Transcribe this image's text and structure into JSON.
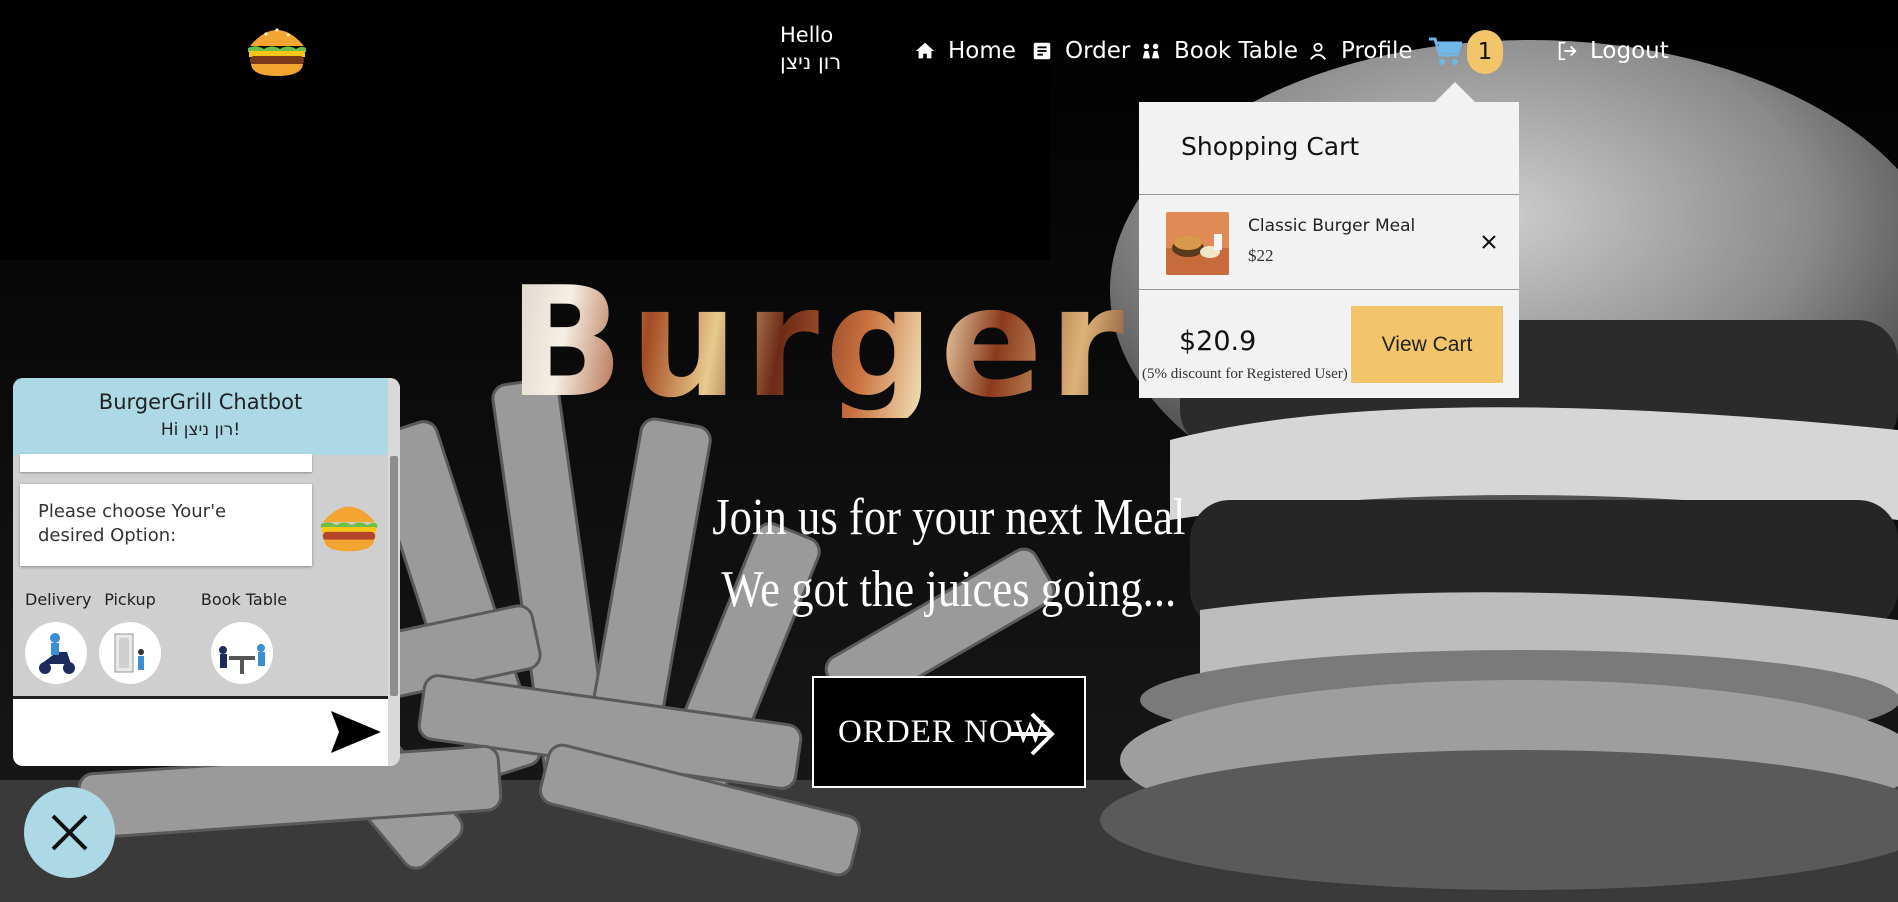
{
  "header": {
    "logo_icon": "burger-icon",
    "greeting": "Hello",
    "user_name": "רון ניצן",
    "nav": [
      {
        "label": "Home",
        "icon": "home-icon"
      },
      {
        "label": "Order",
        "icon": "menu-book-icon"
      },
      {
        "label": "Book Table",
        "icon": "people-icon"
      },
      {
        "label": "Profile",
        "icon": "person-icon"
      }
    ],
    "cart_count": "1",
    "logout_label": "Logout"
  },
  "cart_dropdown": {
    "title": "Shopping Cart",
    "items": [
      {
        "name": "Classic Burger Meal",
        "price": "$22"
      }
    ],
    "total": "$20.9",
    "discount_note": "(5% discount for Registered User)",
    "view_cart_label": "View Cart"
  },
  "hero": {
    "title": "Burger G",
    "tagline_1": "Join us for your next Meal",
    "tagline_2": "We got the juices going...",
    "cta_label": "ORDER NOW"
  },
  "chatbot": {
    "title": "BurgerGrill Chatbot",
    "greeting": "Hi רון ניצן!",
    "message": "Please choose Your'e desired Option:",
    "options": [
      {
        "label": "Delivery",
        "icon": "delivery-scooter-icon"
      },
      {
        "label": "Pickup",
        "icon": "pickup-door-icon"
      },
      {
        "label": "Book Table",
        "icon": "dining-table-icon"
      }
    ],
    "input_value": "",
    "send_icon": "send-icon",
    "close_icon": "close-icon"
  },
  "colors": {
    "accent": "#f3c56a",
    "chat_header": "#add8e6",
    "cart_bg": "#f2f2f2"
  }
}
